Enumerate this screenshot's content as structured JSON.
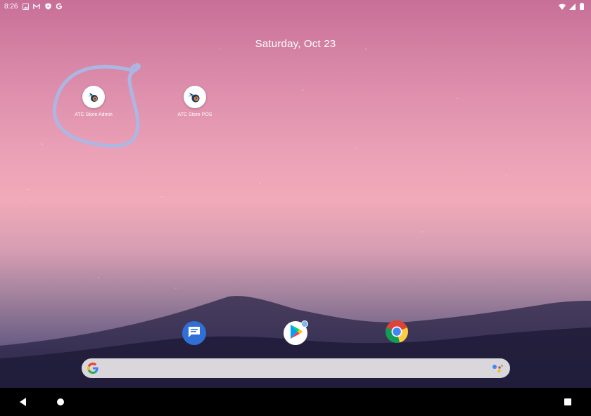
{
  "status_bar": {
    "time": "8:26",
    "notification_icons": [
      "photo-icon",
      "gmail-icon",
      "shield-icon",
      "google-icon"
    ],
    "system_icons": [
      "wifi-icon",
      "signal-icon",
      "battery-icon"
    ]
  },
  "date": "Saturday, Oct 23",
  "apps": [
    {
      "label": "ATC Store Admin",
      "icon": "atc-store-admin-icon"
    },
    {
      "label": "ATC Store POS",
      "icon": "atc-store-pos-icon"
    }
  ],
  "dock": [
    {
      "app": "Messages",
      "icon": "messages-icon"
    },
    {
      "app": "Play Store",
      "icon": "play-store-icon"
    },
    {
      "app": "Chrome",
      "icon": "chrome-icon"
    }
  ],
  "search": {
    "left_icon": "google-g-icon",
    "right_icon": "google-assistant-icon",
    "placeholder": ""
  },
  "nav_bar": {
    "buttons": [
      "back-button",
      "home-button",
      "recents-button"
    ]
  },
  "colors": {
    "annotation": "#aab8e6",
    "navbar": "#000000",
    "searchbar": "#d9d6dc"
  }
}
